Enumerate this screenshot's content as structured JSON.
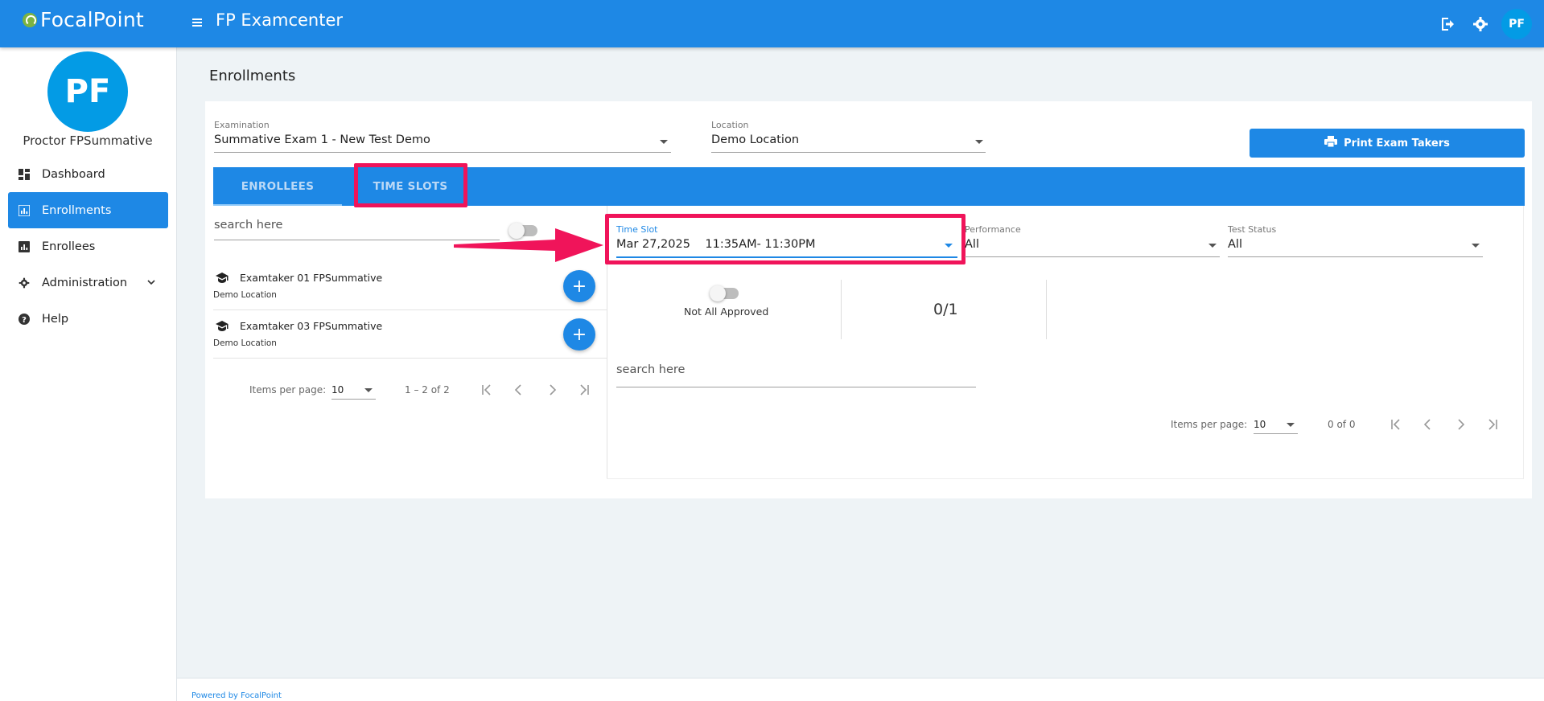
{
  "topbar": {
    "brand": "FocalPoint",
    "app_title": "FP Examcenter",
    "avatar_initials": "PF"
  },
  "sidebar": {
    "avatar_initials": "PF",
    "user_name": "Proctor FPSummative",
    "items": [
      {
        "label": "Dashboard",
        "icon": "dashboard-icon",
        "active": false
      },
      {
        "label": "Enrollments",
        "icon": "bar-chart-icon",
        "active": true
      },
      {
        "label": "Enrollees",
        "icon": "bar-chart-icon",
        "active": false
      },
      {
        "label": "Administration",
        "icon": "gear-icon",
        "active": false
      },
      {
        "label": "Help",
        "icon": "help-icon",
        "active": false
      }
    ]
  },
  "page": {
    "title": "Enrollments"
  },
  "filters": {
    "examination_label": "Examination",
    "examination_value": "Summative Exam 1 - New Test Demo",
    "location_label": "Location",
    "location_value": "Demo Location",
    "print_button": "Print Exam Takers"
  },
  "tabs": {
    "enrollees": "ENROLLEES",
    "time_slots": "TIME SLOTS"
  },
  "left_panel": {
    "search_placeholder": "search here",
    "enrollees": [
      {
        "name": "Examtaker 01 FPSummative",
        "location": "Demo Location"
      },
      {
        "name": "Examtaker 03 FPSummative",
        "location": "Demo Location"
      }
    ],
    "items_per_page_label": "Items per page:",
    "items_per_page": "10",
    "range": "1 – 2 of 2"
  },
  "right_panel": {
    "time_slot_label": "Time Slot",
    "time_slot_value": "Mar 27,2025    11:35AM- 11:30PM",
    "performance_label": "Performance",
    "performance_value": "All",
    "test_status_label": "Test Status",
    "test_status_value": "All",
    "approval_label": "Not All Approved",
    "approval_count": "0/1",
    "search_placeholder": "search here",
    "items_per_page_label": "Items per page:",
    "items_per_page": "10",
    "range": "0 of 0"
  },
  "footer": {
    "text": "Powered by FocalPoint"
  },
  "colors": {
    "primary": "#1e88e5",
    "avatar": "#039be5",
    "highlight": "#f0145a"
  }
}
